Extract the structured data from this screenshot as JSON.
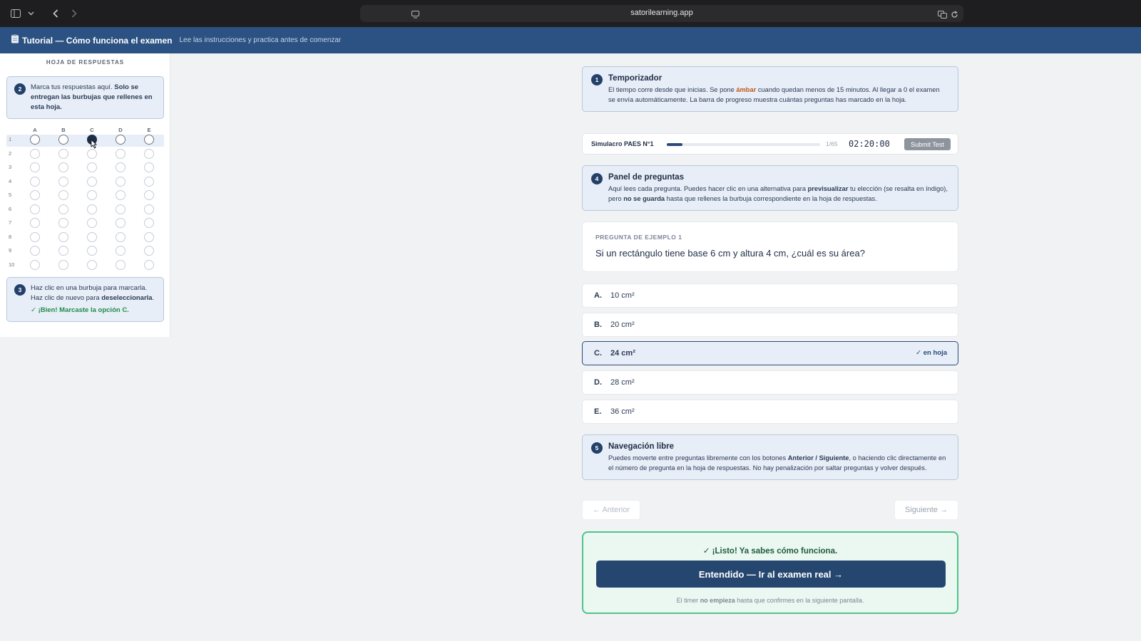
{
  "browser": {
    "url": "satorilearning.app"
  },
  "header": {
    "icon": "clipboard-icon",
    "title": "Tutorial — Cómo funciona el examen",
    "subtitle": "Lee las instrucciones y practica antes de comenzar"
  },
  "sheet": {
    "title": "HOJA DE RESPUESTAS",
    "tip2": {
      "step": "2",
      "text_plain": "Marca tus respuestas aquí. ",
      "text_bold": "Solo se entregan las burbujas que rellenes en esta hoja."
    },
    "columns": [
      "A",
      "B",
      "C",
      "D",
      "E"
    ],
    "rows": [
      "1",
      "2",
      "3",
      "4",
      "5",
      "6",
      "7",
      "8",
      "9",
      "10"
    ],
    "selected": {
      "row": "1",
      "column": "C"
    },
    "tip3": {
      "step": "3",
      "text_plain": "Haz clic en una burbuja para marcarla. Haz clic de nuevo para ",
      "text_bold": "deseleccionarla",
      "text_end": ".",
      "success": "✓ ¡Bien! Marcaste la opción C."
    }
  },
  "timer_info": {
    "step": "1",
    "title": "Temporizador",
    "text_1": "El tiempo corre desde que inicias. Se pone ",
    "text_amber": "ámbar",
    "text_2": " cuando quedan menos de 15 minutos. Al llegar a 0 el examen se envía automáticamente. La barra de progreso muestra cuántas preguntas has marcado en la hoja."
  },
  "timer_bar": {
    "name": "Simulacro PAES N°1",
    "progress": 0.1,
    "count": "1/65",
    "time": "02:20:00",
    "submit_label": "Submit Test"
  },
  "panel_info": {
    "step": "4",
    "title": "Panel de preguntas",
    "text_1": "Aquí lees cada pregunta. Puedes hacer clic en una alternativa para ",
    "text_bold_1": "previsualizar",
    "text_2": " tu elección (se resalta en índigo), pero ",
    "text_bold_2": "no se guarda",
    "text_3": " hasta que rellenes la burbuja correspondiente en la hoja de respuestas."
  },
  "question": {
    "label": "PREGUNTA DE EJEMPLO 1",
    "text": "Si un rectángulo tiene base 6 cm y altura 4 cm, ¿cuál es su área?"
  },
  "options": [
    {
      "letter": "A.",
      "value": "10 cm²"
    },
    {
      "letter": "B.",
      "value": "20 cm²"
    },
    {
      "letter": "C.",
      "value": "24 cm²",
      "marker": "✓ en hoja"
    },
    {
      "letter": "D.",
      "value": "28 cm²"
    },
    {
      "letter": "E.",
      "value": "36 cm²"
    }
  ],
  "nav_info": {
    "step": "5",
    "title": "Navegación libre",
    "text_1": "Puedes moverte entre preguntas libremente con los botones ",
    "text_bold": "Anterior / Siguiente",
    "text_2": ", o haciendo clic directamente en el número de pregunta en la hoja de respuestas. No hay penalización por saltar preguntas y volver después."
  },
  "navigation": {
    "prev_label": "← Anterior",
    "next_label": "Siguiente →"
  },
  "cta": {
    "ok_text": "✓ ¡Listo! Ya sabes cómo funciona.",
    "button_label": "Entendido — Ir al examen real →",
    "note_1": "El timer ",
    "note_bold": "no empieza",
    "note_2": " hasta que confirmes en la siguiente pantalla."
  },
  "colors": {
    "header_blue": "#2b5282",
    "accent_dark": "#24466f",
    "amber": "#c5561b",
    "success_green": "#1f8a4a",
    "cta_border": "#4fc48a"
  }
}
